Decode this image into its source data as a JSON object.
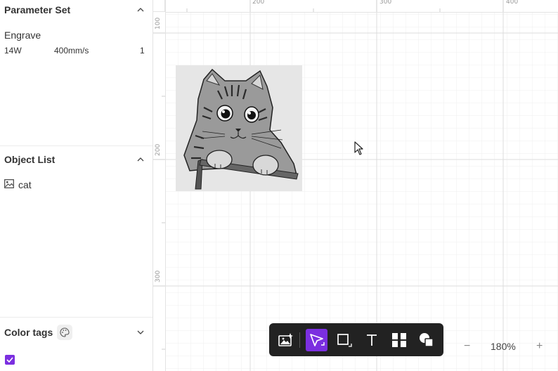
{
  "parameter_set": {
    "title": "Parameter Set",
    "name": "Engrave",
    "power": "14W",
    "speed": "400mm/s",
    "passes": "1"
  },
  "object_list": {
    "title": "Object List",
    "items": [
      {
        "label": "cat",
        "icon": "image-icon"
      }
    ]
  },
  "color_tags": {
    "title": "Color tags",
    "checked": true,
    "check_color": "#7b2fe0"
  },
  "ruler": {
    "top_labels": [
      "200",
      "300",
      "400"
    ],
    "left_labels": [
      "100",
      "200",
      "300"
    ]
  },
  "toolbar": {
    "tools": [
      {
        "name": "image-ai-tool",
        "icon": "image-sparkle-icon",
        "active": false
      },
      {
        "name": "select-tool",
        "icon": "pointer-icon",
        "active": true
      },
      {
        "name": "rectangle-tool",
        "icon": "rectangle-icon",
        "active": false
      },
      {
        "name": "text-tool",
        "icon": "text-icon",
        "active": false
      },
      {
        "name": "elements-tool",
        "icon": "grid-shapes-icon",
        "active": false
      },
      {
        "name": "shapes-tool",
        "icon": "shapes-icon",
        "active": false
      }
    ],
    "accent": "#7b2fe0"
  },
  "zoom": {
    "value": "180%",
    "minus": "−",
    "plus": "+"
  }
}
